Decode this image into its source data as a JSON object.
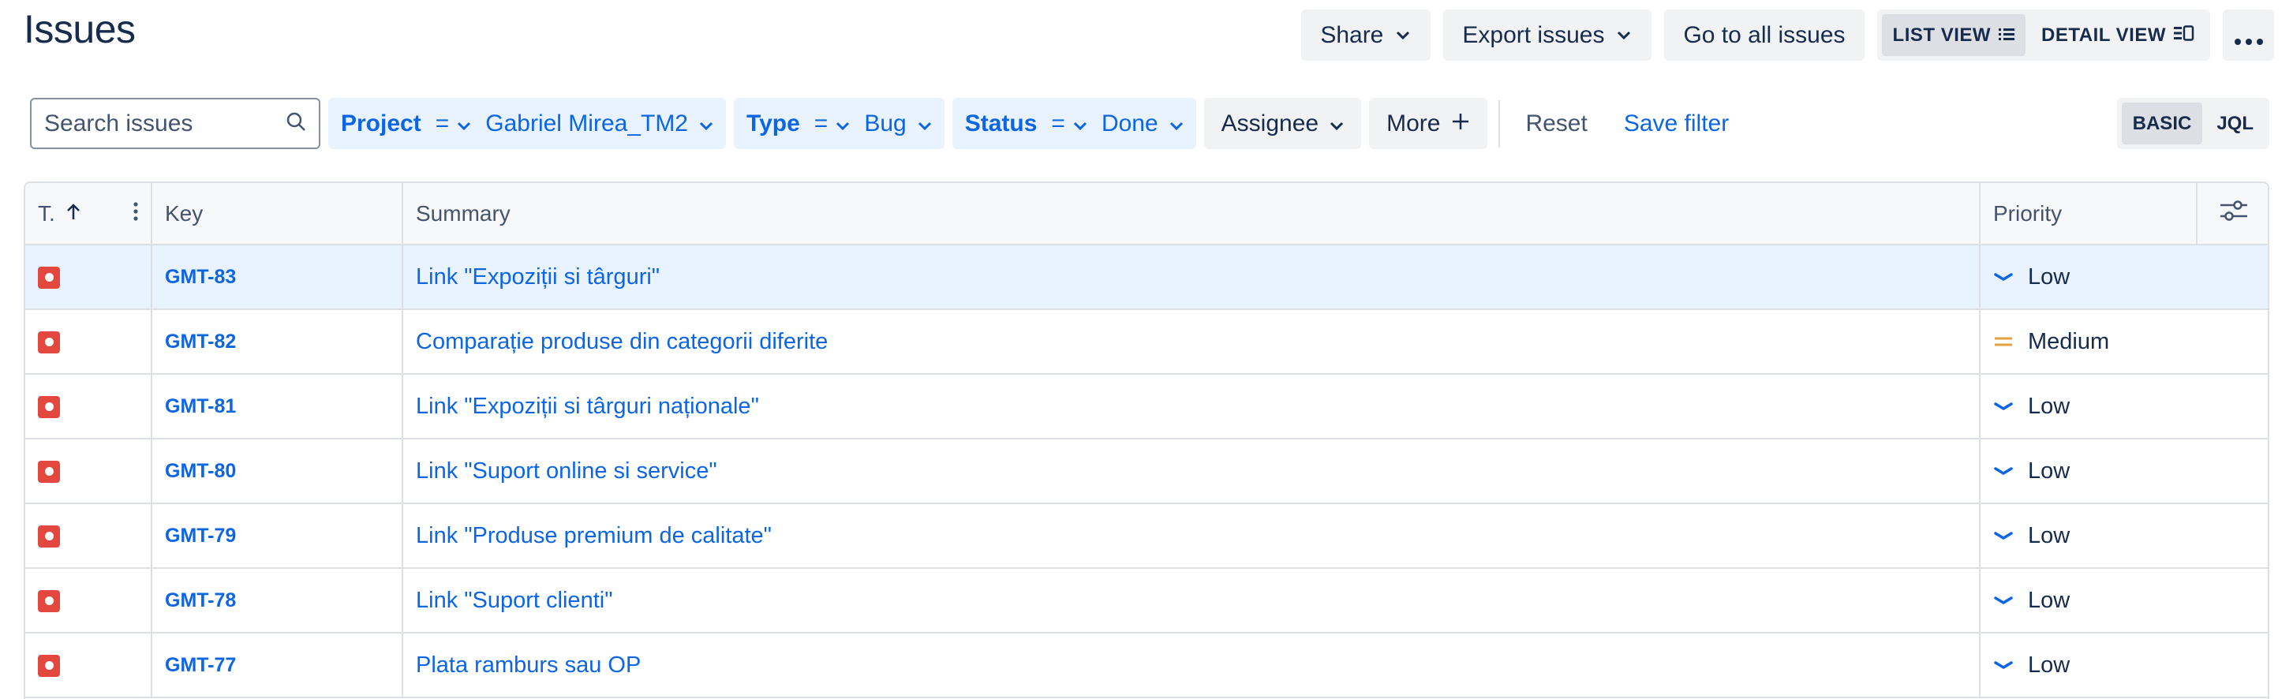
{
  "page": {
    "title": "Issues"
  },
  "top_actions": {
    "share": "Share",
    "export": "Export issues",
    "go_all": "Go to all issues",
    "list_view": "LIST VIEW",
    "detail_view": "DETAIL VIEW"
  },
  "filters": {
    "search_placeholder": "Search issues",
    "project": {
      "key": "Project",
      "op": "=",
      "value": "Gabriel Mirea_TM2"
    },
    "type": {
      "key": "Type",
      "op": "=",
      "value": "Bug"
    },
    "status": {
      "key": "Status",
      "op": "=",
      "value": "Done"
    },
    "assignee": "Assignee",
    "more": "More",
    "reset": "Reset",
    "save_filter": "Save filter",
    "mode_basic": "BASIC",
    "mode_jql": "JQL"
  },
  "table": {
    "headers": {
      "type": "T.",
      "key": "Key",
      "summary": "Summary",
      "priority": "Priority"
    },
    "rows": [
      {
        "key": "GMT-83",
        "summary": "Link \"Expoziții si târguri\"",
        "priority": "Low",
        "selected": true
      },
      {
        "key": "GMT-82",
        "summary": "Comparație produse din categorii diferite",
        "priority": "Medium"
      },
      {
        "key": "GMT-81",
        "summary": "Link \"Expoziții si târguri naționale\"",
        "priority": "Low"
      },
      {
        "key": "GMT-80",
        "summary": "Link \"Suport online si service\"",
        "priority": "Low"
      },
      {
        "key": "GMT-79",
        "summary": "Link \"Produse premium de calitate\"",
        "priority": "Low"
      },
      {
        "key": "GMT-78",
        "summary": "Link \"Suport clienti\"",
        "priority": "Low"
      },
      {
        "key": "GMT-77",
        "summary": "Plata ramburs sau OP",
        "priority": "Low"
      }
    ]
  },
  "colors": {
    "accent": "#0c66e4",
    "bug": "#e2483d",
    "low": "#0c66e4",
    "medium": "#e2a03f",
    "selected_row": "#e9f2ff"
  }
}
